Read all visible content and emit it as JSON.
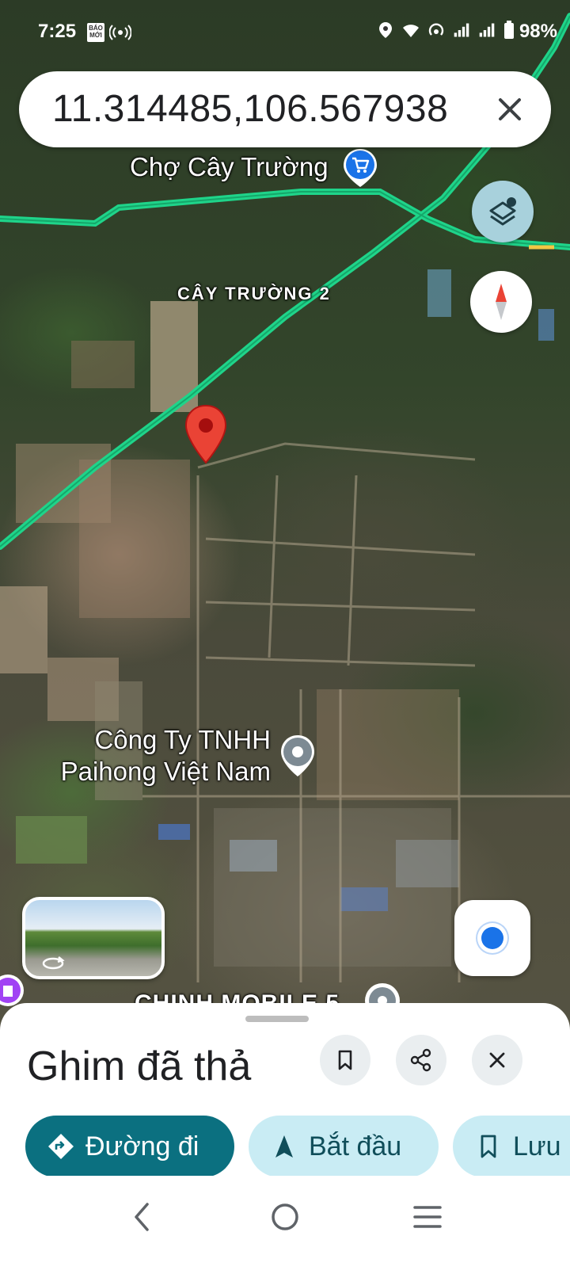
{
  "status_bar": {
    "time": "7:25",
    "badge": "BÁO MỚI",
    "battery": "98%"
  },
  "search": {
    "query": "11.314485,106.567938"
  },
  "map": {
    "labels": {
      "market": "Chợ Cây Trường",
      "area": "CÂY TRƯỜNG 2",
      "company_line1": "Công Ty TNHH",
      "company_line2": "Paihong Việt Nam",
      "partial": "CHINH MOBILE 5"
    },
    "colors": {
      "road": "#1fd48a",
      "pin": "#ea4335",
      "accent": "#0b7080"
    },
    "icons": [
      "layers-icon",
      "compass-icon",
      "my-location-icon",
      "shopping-cart-icon",
      "place-icon",
      "street-view-rotate-icon"
    ]
  },
  "sheet": {
    "title": "Ghim đã thả",
    "actions": {
      "directions": "Đường đi",
      "start": "Bắt đầu",
      "save": "Lưu"
    }
  },
  "nav": {
    "icons": [
      "back-icon",
      "home-icon",
      "recents-icon"
    ]
  }
}
